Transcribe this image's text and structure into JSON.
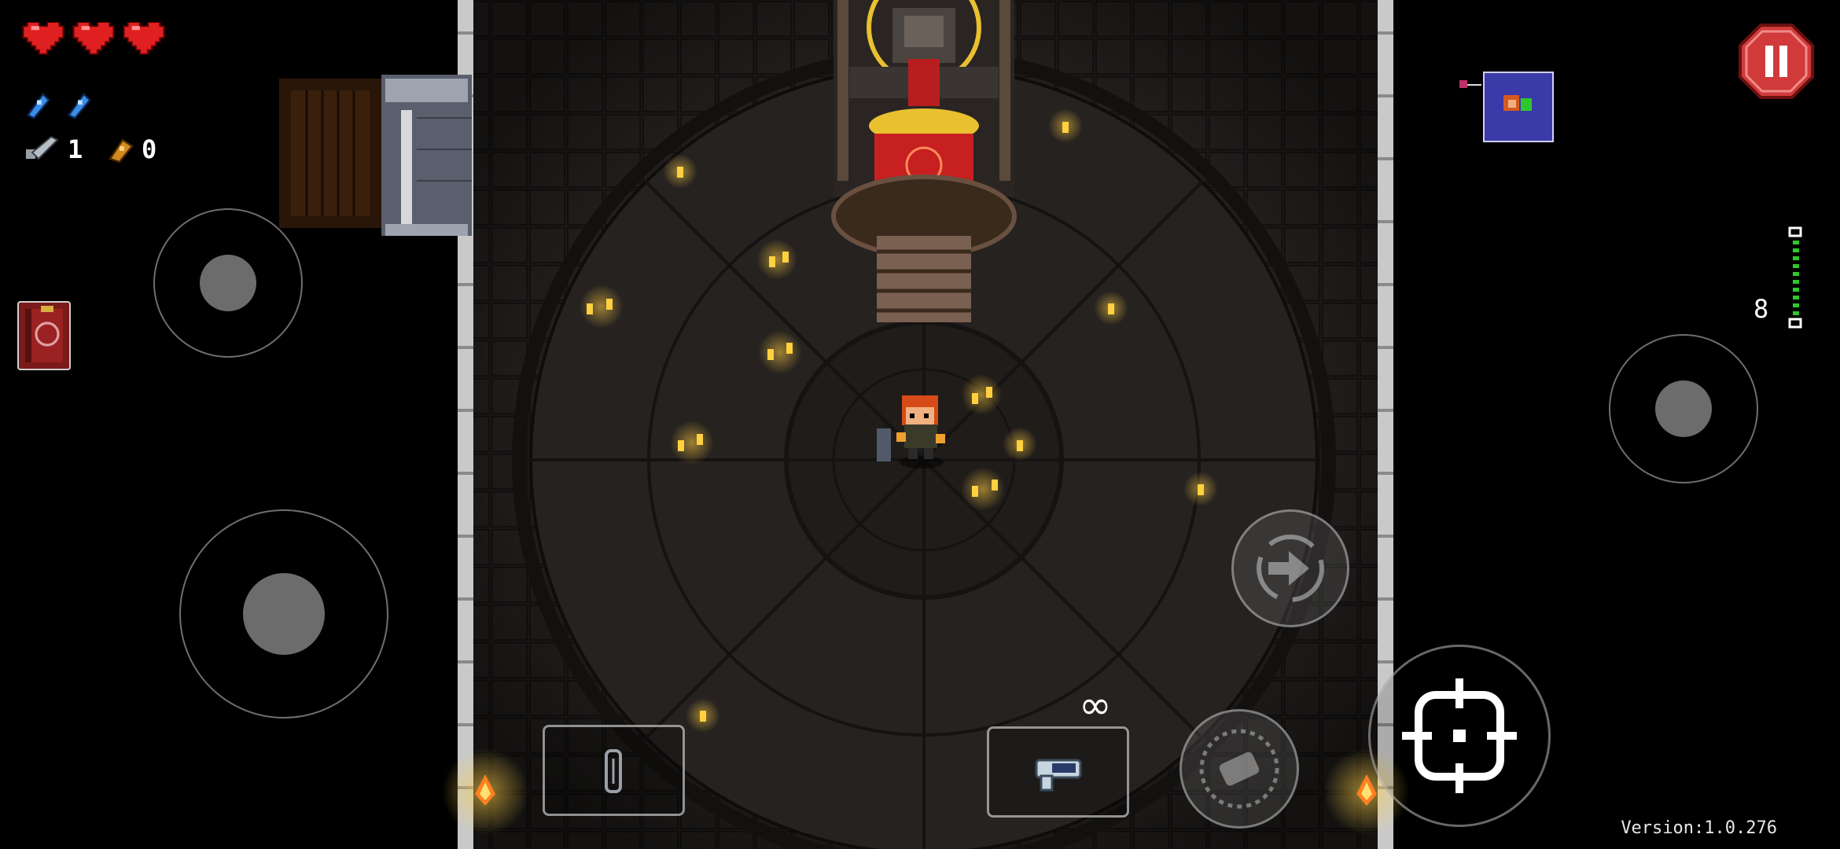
{
  "hud": {
    "hearts": 3,
    "blanks": 2,
    "keys_count": "1",
    "shells_count": "0",
    "ammo_display": "∞",
    "ammo_side_count": "8",
    "version_label": "Version:1.0.276"
  },
  "icons": {
    "heart": "heart-icon",
    "blank": "blank-icon",
    "key": "key-icon",
    "shell": "shell-currency-icon",
    "pause": "pause-icon",
    "map": "minimap-icon",
    "item": "active-item-book-icon",
    "reload": "reload-icon",
    "dodge": "dodge-roll-icon",
    "aim": "aim-crosshair-icon",
    "item_slot": "item-slot-icon",
    "gun_slot": "gun-slot-icon"
  },
  "colors": {
    "heart_red": "#e02020",
    "blank_blue": "#3a8ee6",
    "pause_red": "#d13a3a",
    "candle_glow": "#ffcc44",
    "floor": "#1e1b18"
  }
}
